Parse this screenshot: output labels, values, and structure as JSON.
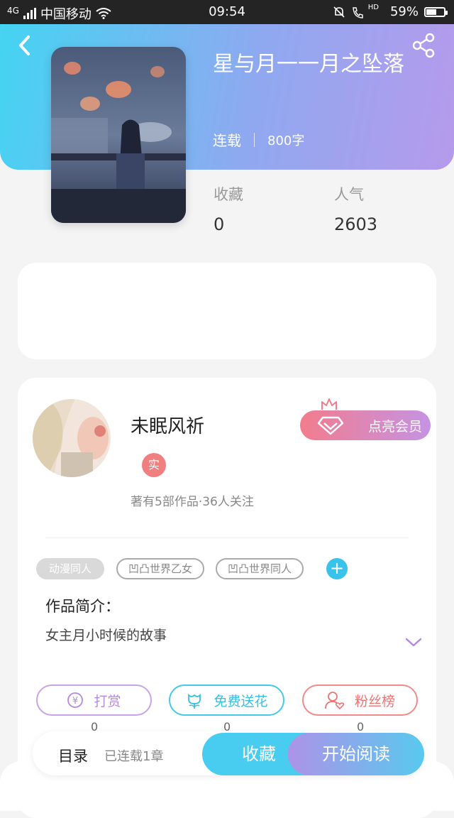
{
  "status_bar": {
    "network": "4G",
    "carrier": "中国移动",
    "time": "09:54",
    "hd_label": "HD",
    "battery": "59%",
    "battery_level": 0.59
  },
  "book": {
    "title": "星与月一一月之坠落",
    "status": "连载",
    "words": "800字",
    "favorites_label": "收藏",
    "favorites_value": "0",
    "popularity_label": "人气",
    "popularity_value": "2603"
  },
  "author": {
    "name": "未眠风祈",
    "badge": "实",
    "meta": "著有5部作品·36人关注",
    "vip_button": "点亮会员"
  },
  "tags": [
    "动漫同人",
    "凹凸世界乙女",
    "凹凸世界同人"
  ],
  "add_tag_label": "+",
  "intro": {
    "title": "作品简介：",
    "text": "女主月小时候的故事"
  },
  "actions": {
    "reward": {
      "label": "打赏",
      "count": "0",
      "icon_text": "¥"
    },
    "flower": {
      "label": "免费送花",
      "count": "0"
    },
    "fans": {
      "label": "粉丝榜",
      "count": "0"
    }
  },
  "bottom": {
    "toc": "目录",
    "toc_sub": "已连载1章",
    "collect": "收藏",
    "read": "开始阅读"
  },
  "colors": {
    "header_gradient_start": "#44d4f2",
    "header_gradient_end": "#b69aec",
    "accent_blue": "#48cdf0",
    "vip_pink": "#f27c8d"
  }
}
